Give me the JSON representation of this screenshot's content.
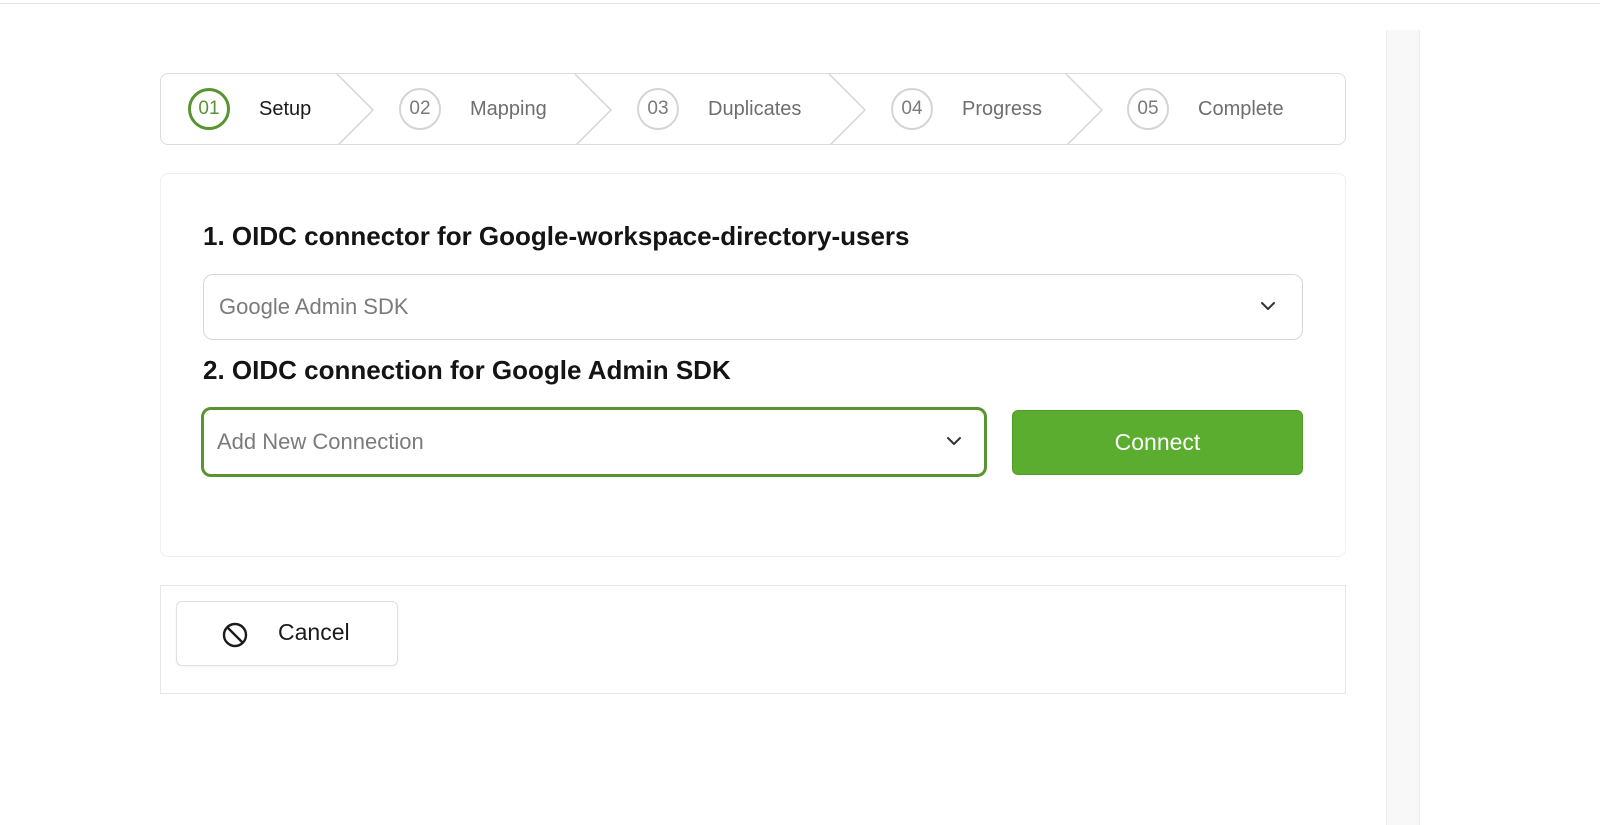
{
  "stepper": {
    "steps": [
      {
        "number": "01",
        "label": "Setup",
        "active": true
      },
      {
        "number": "02",
        "label": "Mapping",
        "active": false
      },
      {
        "number": "03",
        "label": "Duplicates",
        "active": false
      },
      {
        "number": "04",
        "label": "Progress",
        "active": false
      },
      {
        "number": "05",
        "label": "Complete",
        "active": false
      }
    ]
  },
  "form": {
    "connector": {
      "title": "1. OIDC connector for Google-workspace-directory-users",
      "selected": "Google Admin SDK"
    },
    "connection": {
      "title": "2. OIDC connection for Google Admin SDK",
      "selected": "Add New Connection"
    },
    "connect_label": "Connect"
  },
  "footer": {
    "cancel_label": "Cancel"
  },
  "colors": {
    "accent": "#5a9331",
    "button_green": "#5aad2e"
  },
  "icons": {
    "dropdown": "chevron-down-icon",
    "cancel": "no-entry-icon"
  }
}
